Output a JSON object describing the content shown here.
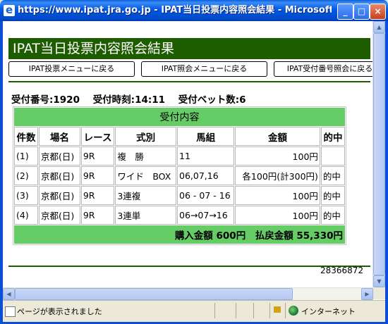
{
  "window": {
    "title": "https://www.ipat.jra.go.jp - IPAT当日投票内容照会結果 - Microsoft Internet Explorer",
    "buttons": {
      "minimize": "_",
      "maximize": "□",
      "close": "×"
    }
  },
  "page": {
    "header": "IPAT当日投票内容照会結果",
    "nav": [
      "IPAT投票メニューに戻る",
      "IPAT照会メニューに戻る",
      "IPAT受付番号照会に戻る"
    ],
    "receipt_number": "受付番号:1920",
    "receipt_time": "受付時刻:14:11",
    "bet_count": "受付ベット数:6",
    "table": {
      "caption": "受付内容",
      "headers": [
        "件数",
        "場名",
        "レース",
        "式別",
        "馬組",
        "金額",
        "的中"
      ],
      "rows": [
        [
          "(1)",
          "京都(日)",
          "9R",
          "複　勝",
          "11",
          "100円",
          ""
        ],
        [
          "(2)",
          "京都(日)",
          "9R",
          "ワイド　BOX",
          "06,07,16",
          "各100円(計300円)",
          "的中"
        ],
        [
          "(3)",
          "京都(日)",
          "9R",
          "3連複",
          "06 - 07 - 16",
          "100円",
          "的中"
        ],
        [
          "(4)",
          "京都(日)",
          "9R",
          "3連単",
          "06→07→16",
          "100円",
          "的中"
        ]
      ],
      "total": "購入金額 600円　払戻金額 55,330円"
    },
    "code": "28366872"
  },
  "status": {
    "text": "ページが表示されました",
    "zone": "インターネット"
  },
  "colors": {
    "header_bg": "#1e5c00",
    "table_accent": "#66cc66",
    "titlebar": "#0058e6"
  }
}
